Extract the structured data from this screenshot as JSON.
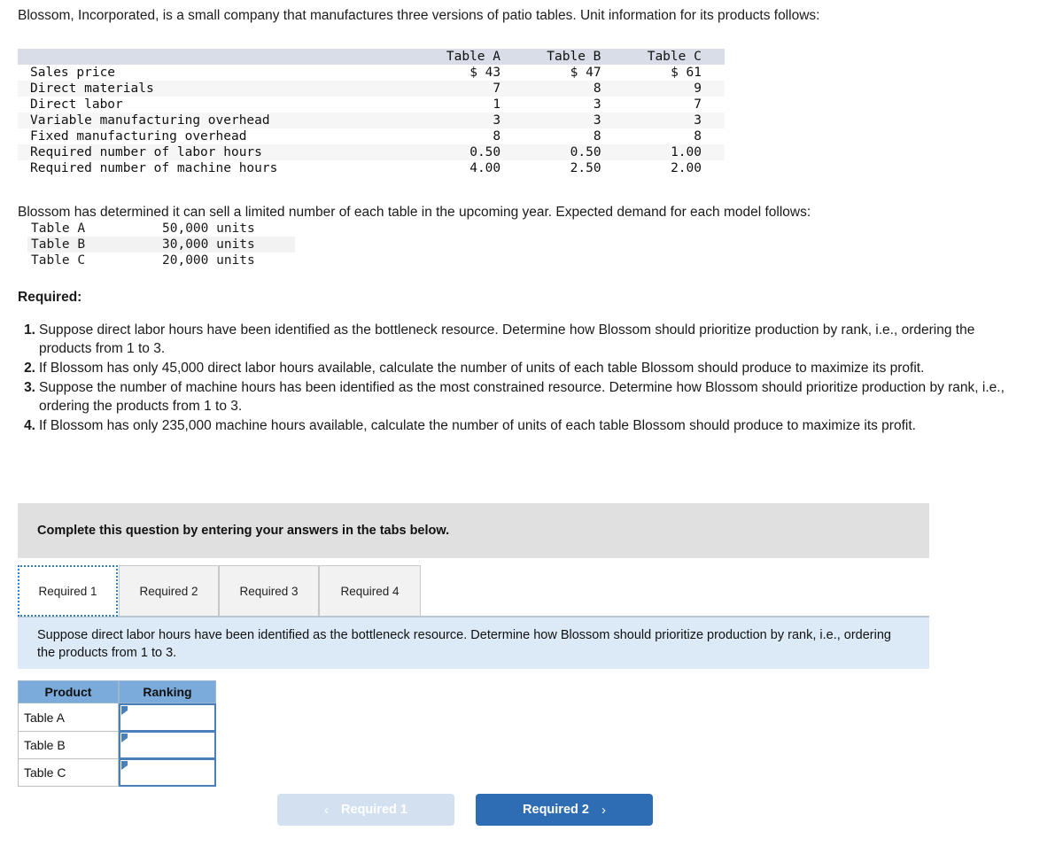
{
  "intro": {
    "paragraph": "Blossom, Incorporated, is a small company that manufactures three versions of patio tables. Unit information for its products follows:"
  },
  "unit_table": {
    "columns": [
      "Table A",
      "Table B",
      "Table C"
    ],
    "rows": [
      {
        "label": "Sales price",
        "a": "$ 43",
        "b": "$ 47",
        "c": "$ 61"
      },
      {
        "label": "Direct materials",
        "a": "7",
        "b": "8",
        "c": "9"
      },
      {
        "label": "Direct labor",
        "a": "1",
        "b": "3",
        "c": "7"
      },
      {
        "label": "Variable manufacturing overhead",
        "a": "3",
        "b": "3",
        "c": "3"
      },
      {
        "label": "Fixed manufacturing overhead",
        "a": "8",
        "b": "8",
        "c": "8"
      },
      {
        "label": "Required number of labor hours",
        "a": "0.50",
        "b": "0.50",
        "c": "1.00"
      },
      {
        "label": "Required number of machine hours",
        "a": "4.00",
        "b": "2.50",
        "c": "2.00"
      }
    ]
  },
  "demand": {
    "lead": "Blossom has determined it can sell a limited number of each table in the upcoming year. Expected demand for each model follows:",
    "rows": [
      {
        "name": "Table A",
        "units": "50,000 units"
      },
      {
        "name": "Table B",
        "units": "30,000 units"
      },
      {
        "name": "Table C",
        "units": "20,000 units"
      }
    ]
  },
  "required": {
    "heading": "Required:",
    "items": [
      {
        "num": "1.",
        "text": "Suppose direct labor hours have been identified as the bottleneck resource. Determine how Blossom should prioritize production by rank, i.e., ordering the products from 1 to 3."
      },
      {
        "num": "2.",
        "text": "If Blossom has only 45,000 direct labor hours available, calculate the number of units of each table Blossom should produce to maximize its profit."
      },
      {
        "num": "3.",
        "text": "Suppose the number of machine hours has been identified as the most constrained resource. Determine how Blossom should prioritize production by rank, i.e., ordering the products from 1 to 3."
      },
      {
        "num": "4.",
        "text": "If Blossom has only 235,000 machine hours available, calculate the number of units of each table Blossom should produce to maximize its profit."
      }
    ]
  },
  "instruction_bar": {
    "text": "Complete this question by entering your answers in the tabs below."
  },
  "tabs": {
    "items": [
      {
        "label": "Required 1",
        "active": true
      },
      {
        "label": "Required 2",
        "active": false
      },
      {
        "label": "Required 3",
        "active": false
      },
      {
        "label": "Required 4",
        "active": false
      }
    ]
  },
  "info_panel": {
    "text": "Suppose direct labor hours have been identified as the bottleneck resource. Determine how Blossom should prioritize production by rank, i.e., ordering the products from 1 to 3."
  },
  "answer_table": {
    "headers": {
      "product": "Product",
      "ranking": "Ranking"
    },
    "rows": [
      {
        "product": "Table A",
        "ranking": ""
      },
      {
        "product": "Table B",
        "ranking": ""
      },
      {
        "product": "Table C",
        "ranking": ""
      }
    ]
  },
  "nav": {
    "prev_label": "Required 1",
    "next_label": "Required 2",
    "prev_icon": "chevron-left-icon",
    "next_icon": "chevron-right-icon",
    "prev_chevron": "‹",
    "next_chevron": "›"
  },
  "colors": {
    "table_header_bg": "#d8dde8",
    "instruction_bg": "#e0e0e0",
    "info_panel_bg": "#dceaf7",
    "answer_header_bg": "#7aabdb",
    "input_border": "#4a7fba",
    "next_button_bg": "#2e6db4",
    "prev_button_bg": "#d2e0f0",
    "tab_active_outline": "#2f7fd0"
  }
}
